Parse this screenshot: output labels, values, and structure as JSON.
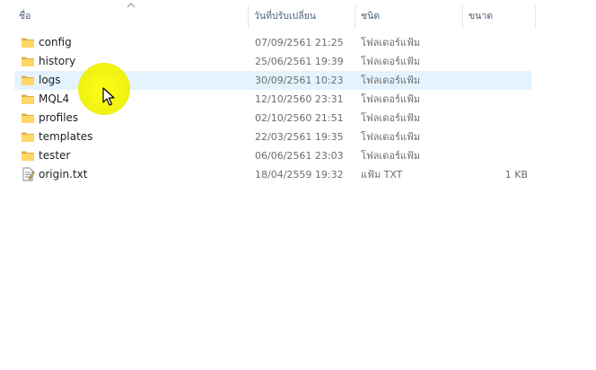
{
  "header": {
    "columns": [
      {
        "label": "ชื่อ"
      },
      {
        "label": "วันที่ปรับเปลี่ยน"
      },
      {
        "label": "ชนิด"
      },
      {
        "label": "ขนาด"
      }
    ]
  },
  "files": [
    {
      "name": "config",
      "date": "07/09/2561 21:25",
      "type": "โฟลเดอร์แฟ้ม",
      "size": "",
      "kind": "folder"
    },
    {
      "name": "history",
      "date": "25/06/2561 19:39",
      "type": "โฟลเดอร์แฟ้ม",
      "size": "",
      "kind": "folder"
    },
    {
      "name": "logs",
      "date": "30/09/2561 10:23",
      "type": "โฟลเดอร์แฟ้ม",
      "size": "",
      "kind": "folder"
    },
    {
      "name": "MQL4",
      "date": "12/10/2560 23:31",
      "type": "โฟลเดอร์แฟ้ม",
      "size": "",
      "kind": "folder"
    },
    {
      "name": "profiles",
      "date": "02/10/2560 21:51",
      "type": "โฟลเดอร์แฟ้ม",
      "size": "",
      "kind": "folder"
    },
    {
      "name": "templates",
      "date": "22/03/2561 19:35",
      "type": "โฟลเดอร์แฟ้ม",
      "size": "",
      "kind": "folder"
    },
    {
      "name": "tester",
      "date": "06/06/2561 23:03",
      "type": "โฟลเดอร์แฟ้ม",
      "size": "",
      "kind": "folder"
    },
    {
      "name": "origin.txt",
      "date": "18/04/2559 19:32",
      "type": "แฟ้ม TXT",
      "size": "1 KB",
      "kind": "text-file"
    }
  ],
  "hovered_row": 2,
  "colors": {
    "folder": "#ffd766",
    "hover": "#e5f3ff",
    "highlight": "#ffff00"
  }
}
